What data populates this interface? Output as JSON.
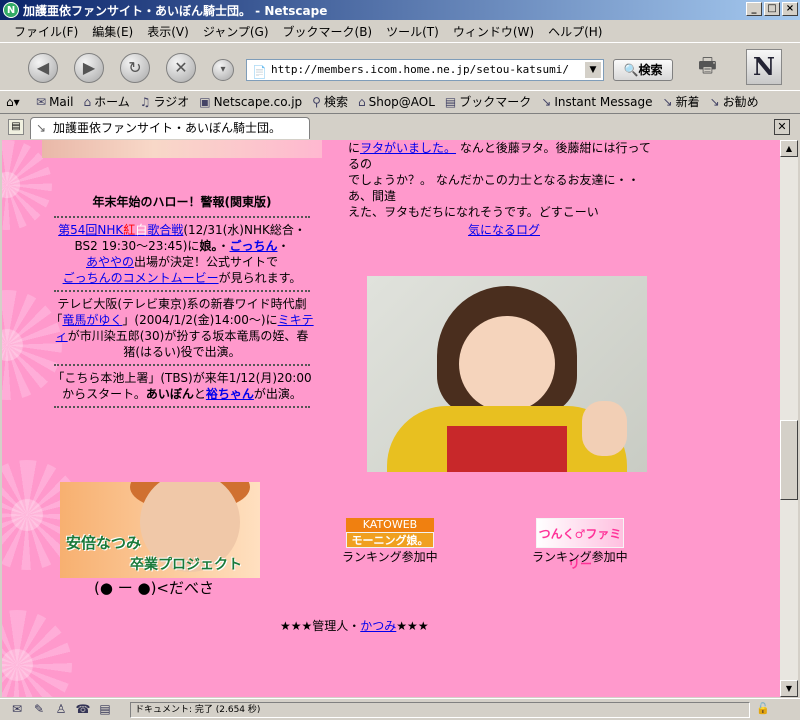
{
  "window": {
    "title": "加護亜依ファンサイト・あいぼん騎士団。 - Netscape",
    "minimize_glyph": "_",
    "maximize_glyph": "□",
    "close_glyph": "×"
  },
  "menu": [
    "ファイル(F)",
    "編集(E)",
    "表示(V)",
    "ジャンプ(G)",
    "ブックマーク(B)",
    "ツール(T)",
    "ウィンドウ(W)",
    "ヘルプ(H)"
  ],
  "nav": {
    "url": "http://members.icom.home.ne.jp/setou-katsumi/",
    "search_label": "検索"
  },
  "personal_toolbar": [
    {
      "icon": "mail-icon",
      "label": "Mail"
    },
    {
      "icon": "home-icon",
      "label": "ホーム"
    },
    {
      "icon": "radio-icon",
      "label": "ラジオ"
    },
    {
      "icon": "my-icon",
      "label": "Netscape.co.jp"
    },
    {
      "icon": "search-icon",
      "label": "検索"
    },
    {
      "icon": "shop-icon",
      "label": "Shop@AOL"
    },
    {
      "icon": "bookmark-icon",
      "label": "ブックマーク"
    },
    {
      "icon": "link-icon",
      "label": "Instant Message"
    },
    {
      "icon": "link-icon",
      "label": "新着"
    },
    {
      "icon": "link-icon",
      "label": "お勧め"
    }
  ],
  "tab": {
    "label": "加護亜依ファンサイト・あいぼん騎士団。"
  },
  "left": {
    "heading": "年末年始のハロー！警報(関東版)",
    "block1": {
      "link1_a": "第54回NHK",
      "link1_red": "紅",
      "link1_white": "白",
      "link1_b": "歌合戦",
      "text1": "(12/31(水)NHK総合・BS2 19:30〜23:45)に",
      "bold1": "娘。",
      "dot1": "・",
      "link2": "ごっちん",
      "dot2": "・",
      "link3": "あややの",
      "text2": "出場が決定！公式サイトで",
      "link4": "ごっちんのコメントムービー",
      "text3": "が見られます。"
    },
    "block2": {
      "text1": "テレビ大阪(テレビ東京)系の新春ワイド時代劇「",
      "link1": "竜馬がゆく",
      "text2": "」(2004/1/2(金)14:00〜)に",
      "link2": "ミキティ",
      "text3": "が市川染五郎(30)が扮する坂本竜馬の姪、春猪(はるい)役で出演。"
    },
    "block3": {
      "text1": "「こちら本池上署」(TBS)が来年1/12(月)20:00からスタート。",
      "bold1": "あいぼん",
      "text2": "と",
      "link1": "裕ちゃん",
      "text3": "が出演。"
    }
  },
  "right": {
    "line1_prefix": "に",
    "line1_link": "ヲタがいました。",
    "line1_text": " なんと後藤ヲタ。後藤紺には行ってるの",
    "line2": "でしょうか？。 なんだかこの力士となるお友達に・・あ、間違",
    "line3": "えた、ヲタもだちになれそうです。どすこーい",
    "log_link": "気になるログ"
  },
  "banners": {
    "natsumi_line1": "安倍なつみ",
    "natsumi_line2": "卒業プロジェクト",
    "daibesa": "(● ー ●)<だべさ",
    "kato_top": "KATOWEB",
    "kato_bottom": "モーニング娘。",
    "rank1": "ランキング参加中",
    "famiry": "つんく♂ファミリー",
    "rank2": "ランキング参加中"
  },
  "admin": {
    "prefix": "★★★管理人・",
    "link": "かつみ",
    "suffix": "★★★"
  },
  "status": {
    "text": "ドキュメント: 完了 (2.654 秒)"
  },
  "colors": {
    "page_background": "#ff99cc",
    "link": "#0000ee"
  }
}
